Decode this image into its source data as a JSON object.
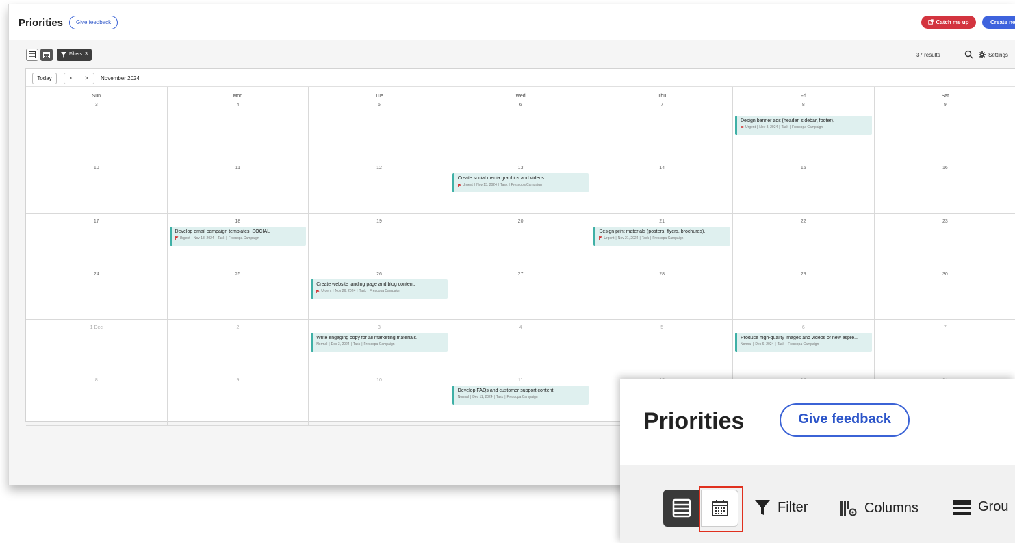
{
  "header": {
    "title": "Priorities",
    "feedback_label": "Give feedback",
    "catch_label": "Catch me up",
    "create_label": "Create new"
  },
  "toolbar": {
    "filters_label": "Filters: 3",
    "results": "37 results",
    "settings_label": "Settings"
  },
  "calendar": {
    "today_label": "Today",
    "prev_label": "<",
    "next_label": ">",
    "month_label": "November 2024",
    "days_of_week": [
      "Sun",
      "Mon",
      "Tue",
      "Wed",
      "Thu",
      "Fri",
      "Sat"
    ],
    "weeks": [
      [
        "3",
        "4",
        "5",
        "6",
        "7",
        "8",
        "9"
      ],
      [
        "10",
        "11",
        "12",
        "13",
        "14",
        "15",
        "16"
      ],
      [
        "17",
        "18",
        "19",
        "20",
        "21",
        "22",
        "23"
      ],
      [
        "24",
        "25",
        "26",
        "27",
        "28",
        "29",
        "30"
      ],
      [
        "1 Dec",
        "2",
        "3",
        "4",
        "5",
        "6",
        "7"
      ],
      [
        "8",
        "9",
        "10",
        "11",
        "12",
        "13",
        "14"
      ]
    ],
    "events": [
      {
        "week": 0,
        "day": 5,
        "title": "Design banner ads (header, sidebar, footer).",
        "priority": "Urgent",
        "date": "Nov 8, 2024",
        "type": "Task",
        "project": "Frescopa Campaign"
      },
      {
        "week": 1,
        "day": 3,
        "title": "Create social media graphics and videos.",
        "priority": "Urgent",
        "date": "Nov 13, 2024",
        "type": "Task",
        "project": "Frescopa Campaign"
      },
      {
        "week": 2,
        "day": 1,
        "title": "Develop email campaign templates. SOCIAL",
        "priority": "Urgent",
        "date": "Nov 18, 2024",
        "type": "Task",
        "project": "Frescopa Campaign"
      },
      {
        "week": 2,
        "day": 4,
        "title": "Design print materials (posters, flyers, brochures).",
        "priority": "Urgent",
        "date": "Nov 21, 2024",
        "type": "Task",
        "project": "Frescopa Campaign"
      },
      {
        "week": 3,
        "day": 2,
        "title": "Create website landing page and blog content.",
        "priority": "Urgent",
        "date": "Nov 26, 2024",
        "type": "Task",
        "project": "Frescopa Campaign"
      },
      {
        "week": 4,
        "day": 2,
        "title": "Write engaging copy for all marketing materials.",
        "priority": "Normal",
        "date": "Dec 3, 2024",
        "type": "Task",
        "project": "Frescopa Campaign"
      },
      {
        "week": 4,
        "day": 5,
        "title": "Produce high-quality images and videos of new espre...",
        "priority": "Normal",
        "date": "Dec 6, 2024",
        "type": "Task",
        "project": "Frescopa Campaign"
      },
      {
        "week": 5,
        "day": 3,
        "title": "Develop FAQs and customer support content.",
        "priority": "Normal",
        "date": "Dec 11, 2024",
        "type": "Task",
        "project": "Frescopa Campaign"
      }
    ]
  },
  "zoom": {
    "title": "Priorities",
    "feedback_label": "Give feedback",
    "filter_label": "Filter",
    "columns_label": "Columns",
    "group_label": "Grou"
  },
  "colors": {
    "accent_blue": "#3e63dd",
    "catch_red": "#d3343f",
    "event_bg": "#dff0ef",
    "event_border": "#3fb0a6",
    "urgent_flag": "#d02c2c",
    "highlight_red": "#e0301e"
  },
  "icons": {
    "list_view": "list-view-icon",
    "calendar_view": "calendar-view-icon",
    "filter": "filter-icon",
    "search": "search-icon",
    "settings": "gear-icon",
    "catch_up": "external-link-icon",
    "columns": "columns-icon",
    "group": "group-icon",
    "urgent": "flag-icon"
  }
}
